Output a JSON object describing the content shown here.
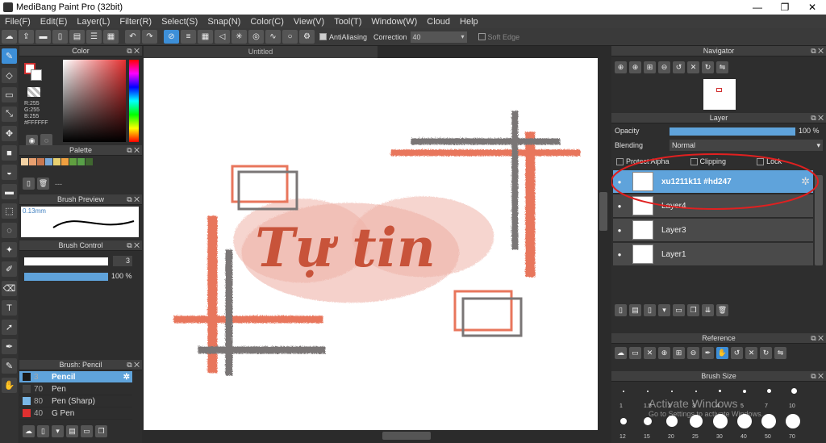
{
  "window": {
    "title": "MediBang Paint Pro (32bit)",
    "minimize": "—",
    "maximize": "❐",
    "close": "✕"
  },
  "menu": [
    "File(F)",
    "Edit(E)",
    "Layer(L)",
    "Filter(R)",
    "Select(S)",
    "Snap(N)",
    "Color(C)",
    "View(V)",
    "Tool(T)",
    "Window(W)",
    "Cloud",
    "Help"
  ],
  "toolbar": {
    "antialiasing": "AntiAliasing",
    "correction_label": "Correction",
    "correction_value": "40",
    "soft_edge": "Soft Edge"
  },
  "color_panel": {
    "title": "Color",
    "r": "R:255",
    "g": "G:255",
    "b": "B:255",
    "hex": "#FFFFFF"
  },
  "palette_panel": {
    "title": "Palette",
    "page_text": "---",
    "swatches": [
      "#f3d2a4",
      "#e8a070",
      "#c87850",
      "#7aa8d8",
      "#e8d070",
      "#f0a040",
      "#60a040",
      "#58a048",
      "#406830"
    ]
  },
  "brush_preview": {
    "title": "Brush Preview",
    "size": "0.13mm"
  },
  "brush_control": {
    "title": "Brush Control",
    "size_value": "3",
    "opacity_value": "100 %"
  },
  "brush_list": {
    "title": "Brush: Pencil",
    "items": [
      {
        "size": "3",
        "name": "Pencil",
        "color": "#1a1a1a",
        "selected": true
      },
      {
        "size": "70",
        "name": "Pen",
        "color": "#444444",
        "selected": false
      },
      {
        "size": "80",
        "name": "Pen (Sharp)",
        "color": "#7ab8e8",
        "selected": false
      },
      {
        "size": "40",
        "name": "G Pen",
        "color": "#e03030",
        "selected": false
      }
    ]
  },
  "document": {
    "tab": "Untitled",
    "artwork_text": "Tự tin"
  },
  "navigator": {
    "title": "Navigator"
  },
  "layer_panel": {
    "title": "Layer",
    "opacity_label": "Opacity",
    "opacity_value": "100 %",
    "opacity_fraction": 1.0,
    "blending_label": "Blending",
    "blending_value": "Normal",
    "protect_alpha": "Protect Alpha",
    "clipping": "Clipping",
    "lock": "Lock",
    "layers": [
      {
        "name": "xu1211k11 #hd247",
        "selected": true
      },
      {
        "name": "Layer4",
        "selected": false
      },
      {
        "name": "Layer3",
        "selected": false
      },
      {
        "name": "Layer1",
        "selected": false
      }
    ]
  },
  "reference": {
    "title": "Reference"
  },
  "brush_size": {
    "title": "Brush Size",
    "row1": [
      "1",
      "1.5",
      "2",
      "3",
      "4",
      "5",
      "7",
      "10"
    ],
    "row2": [
      "12",
      "15",
      "20",
      "25",
      "30",
      "40",
      "50",
      "70"
    ]
  },
  "watermark": {
    "line1": "Activate Windows",
    "line2": "Go to Settings to activate Windows."
  },
  "colors": {
    "accent": "#3d8fd8",
    "selected_row": "#5fa3db",
    "salmon": "#e8765c",
    "gray": "#7a7676",
    "pink": "#efb3a8"
  }
}
